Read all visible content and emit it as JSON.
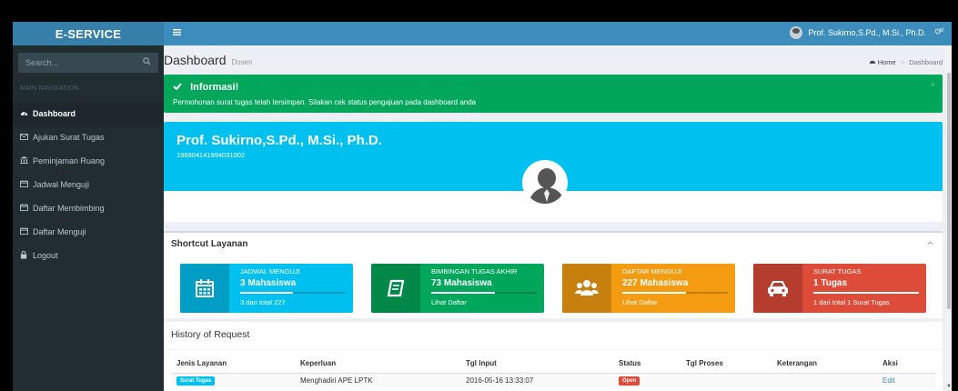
{
  "sidebar": {
    "brand": "E-SERVICE",
    "search_placeholder": "Search...",
    "nav_header": "MAIN NAVIGATION",
    "items": [
      {
        "label": "Dashboard",
        "icon": "dashboard-icon"
      },
      {
        "label": "Ajukan Surat Tugas",
        "icon": "envelope-icon"
      },
      {
        "label": "Peminjaman Ruang",
        "icon": "bank-icon"
      },
      {
        "label": "Jadwal Menguji",
        "icon": "calendar-icon"
      },
      {
        "label": "Daftar Membimbing",
        "icon": "calendar-icon"
      },
      {
        "label": "Daftar Menguji",
        "icon": "calendar-icon"
      },
      {
        "label": "Logout",
        "icon": "lock-icon"
      }
    ]
  },
  "topbar": {
    "user_name": "Prof. Sukirno,S.Pd., M.Si., Ph.D."
  },
  "header": {
    "title": "Dashboard",
    "subtitle": "Dosen",
    "breadcrumb_home": "Home",
    "breadcrumb_current": "Dashboard"
  },
  "alert": {
    "title": "Informasi!",
    "message": "Permohonan surat tugas telah tersimpan. Silakan cek status pengajuan pada dashboard anda",
    "close": "×",
    "color": "#00a65a"
  },
  "profile": {
    "name": "Prof. Sukirno,S.Pd., M.Si., Ph.D.",
    "nip": "196904141994031002"
  },
  "shortcut": {
    "title": "Shortcut Layanan",
    "tiles": [
      {
        "label": "JADWAL MENGUJI",
        "value": "3 Mahasiswa",
        "desc": "3 dari total 227",
        "color": "#00c0ef",
        "icon": "calendar-icon",
        "progress": 0.5
      },
      {
        "label": "BIMBINGAN TUGAS AKHIR",
        "value": "73 Mahasiswa",
        "desc": "Lihat Daftar",
        "color": "#00a65a",
        "icon": "book-icon",
        "progress": 0.6
      },
      {
        "label": "DAFTAR MENGUJI",
        "value": "227 Mahasiswa",
        "desc": "Lihat Daftar",
        "color": "#f39c12",
        "icon": "users-icon",
        "progress": 0.6
      },
      {
        "label": "SURAT TUGAS",
        "value": "1 Tugas",
        "desc": "1 dari total 1 Surat Tugas",
        "color": "#dd4b39",
        "icon": "car-icon",
        "progress": 1.0
      }
    ]
  },
  "history": {
    "title": "History of Request",
    "columns": [
      "Jenis Layanan",
      "Keperluan",
      "Tgl Input",
      "Status",
      "Tgl Proses",
      "Keterangan",
      "Aksi"
    ],
    "rows": [
      {
        "jenis": "Surat Tugas",
        "keperluan": "Menghadiri APE LPTK",
        "tgl_input": "2016-05-16 13:33:07",
        "status": "Open",
        "tgl_proses": "",
        "keterangan": "",
        "aksi": "Edit"
      }
    ]
  }
}
